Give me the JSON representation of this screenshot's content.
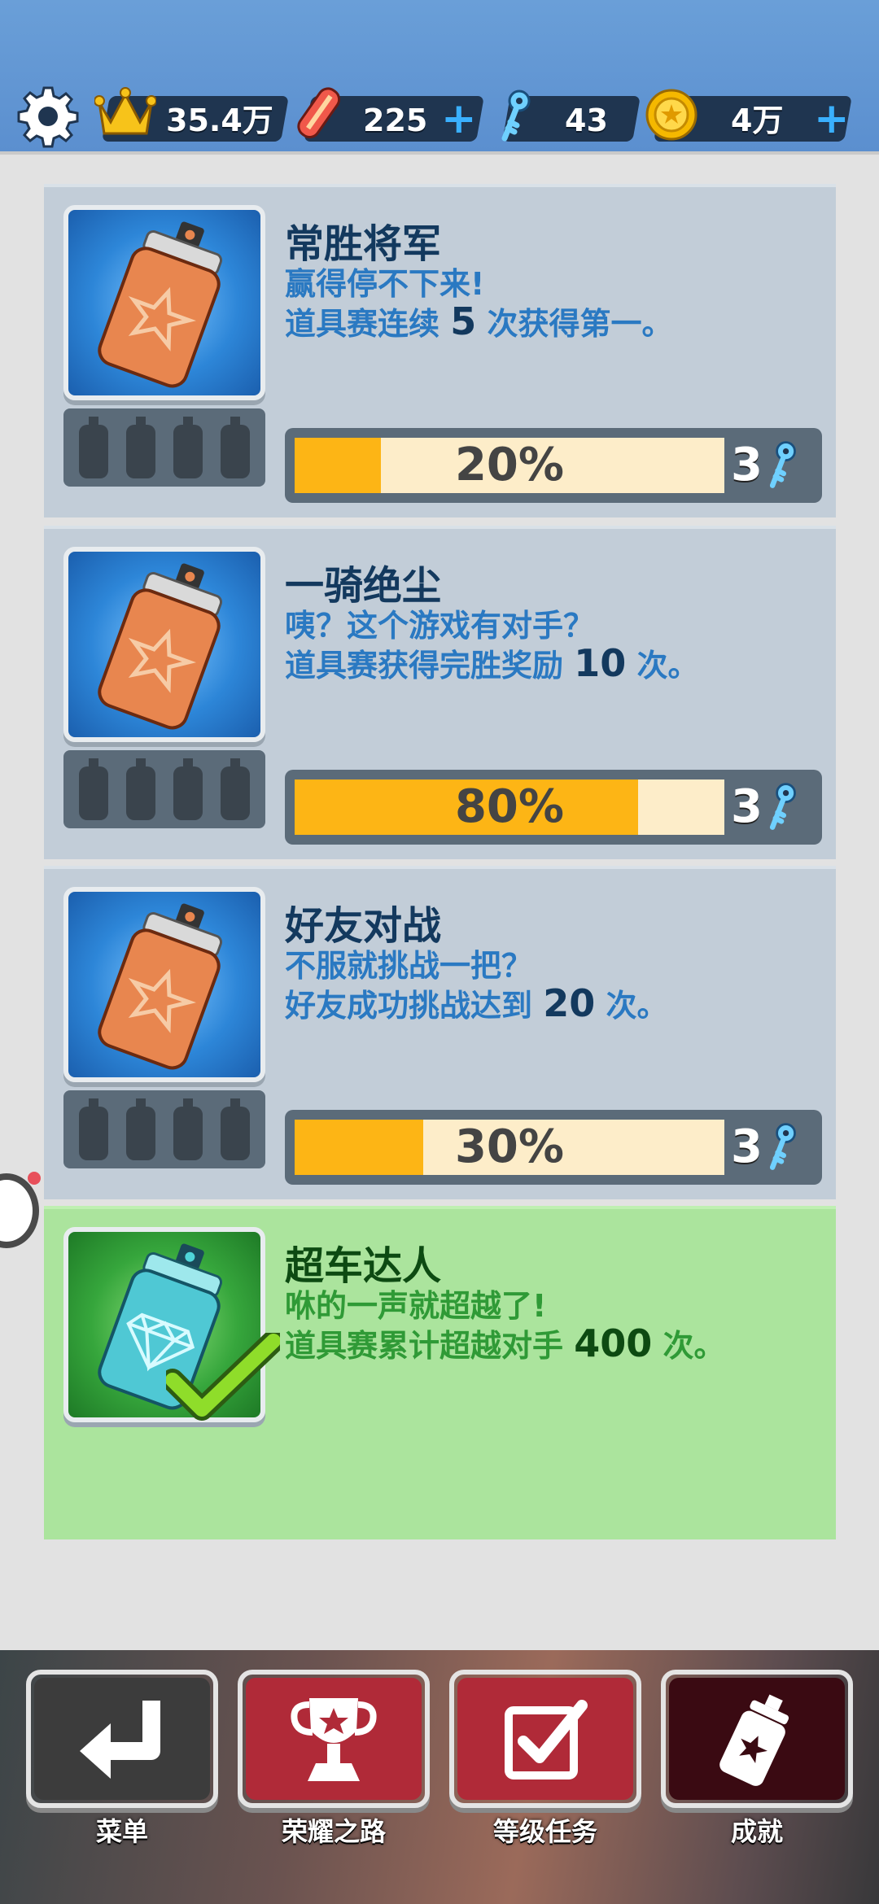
{
  "topbar": {
    "score": "35.4万",
    "boards": "225",
    "keys": "43",
    "coins": "4万"
  },
  "achievements": [
    {
      "title": "常胜将军",
      "desc_line1": "赢得停不下来!",
      "desc_line2_pre": "道具赛连续 ",
      "desc_line2_num": "5",
      "desc_line2_post": " 次获得第一。",
      "progress_text": "20%",
      "progress": 0.2,
      "reward": "3",
      "completed": false
    },
    {
      "title": "一骑绝尘",
      "desc_line1": "咦？这个游戏有对手？",
      "desc_line2_pre": "道具赛获得完胜奖励 ",
      "desc_line2_num": "10",
      "desc_line2_post": " 次。",
      "progress_text": "80%",
      "progress": 0.8,
      "reward": "3",
      "completed": false
    },
    {
      "title": "好友对战",
      "desc_line1": "不服就挑战一把？",
      "desc_line2_pre": "好友成功挑战达到 ",
      "desc_line2_num": "20",
      "desc_line2_post": " 次。",
      "progress_text": "30%",
      "progress": 0.3,
      "reward": "3",
      "completed": false
    },
    {
      "title": "超车达人",
      "desc_line1": "咻的一声就超越了!",
      "desc_line2_pre": "道具赛累计超越对手 ",
      "desc_line2_num": "400",
      "desc_line2_post": " 次。",
      "completed": true
    }
  ],
  "nav": {
    "menu": "菜单",
    "glory": "荣耀之路",
    "tasks": "等级任务",
    "achievements": "成就"
  },
  "colors": {
    "progress_fill": "#fdb515",
    "progress_bg": "#fdedc9",
    "card_bg": "#c2cdd8",
    "done_bg": "#abe49d",
    "title_blue": "#13395e",
    "desc_blue": "#2a79c2"
  },
  "icons": [
    "settings-gear-icon",
    "crown-icon",
    "hoverboard-icon",
    "key-icon",
    "coin-icon",
    "plus-icon",
    "spray-can-icon",
    "checkmark-icon",
    "return-arrow-icon",
    "trophy-icon",
    "checkbox-icon"
  ]
}
